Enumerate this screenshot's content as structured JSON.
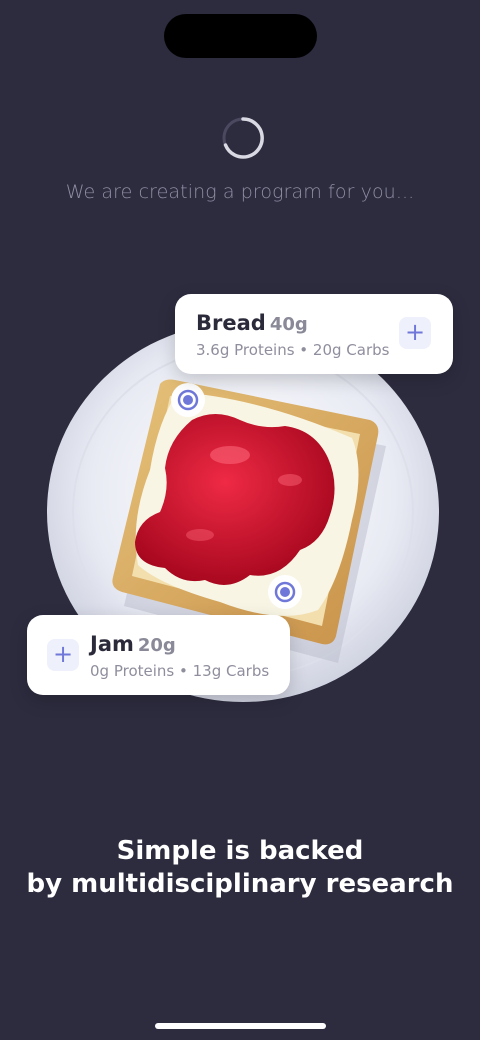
{
  "loading": {
    "text": "We are creating a program for you..."
  },
  "cards": {
    "bread": {
      "name": "Bread",
      "weight": "40g",
      "details": "3.6g Proteins • 20g Carbs",
      "plus_icon": "+"
    },
    "jam": {
      "name": "Jam",
      "weight": "20g",
      "details": "0g Proteins • 13g Carbs",
      "plus_icon": "+"
    }
  },
  "headline": {
    "line1": "Simple is backed",
    "line2": "by multidisciplinary research"
  },
  "colors": {
    "background": "#2d2c3f",
    "accent": "#6f78d9",
    "jam": "#c8102e",
    "plate": "#eceef6"
  },
  "icons": [
    "spinner-icon",
    "plus-icon",
    "marker-dot-icon",
    "home-indicator"
  ]
}
